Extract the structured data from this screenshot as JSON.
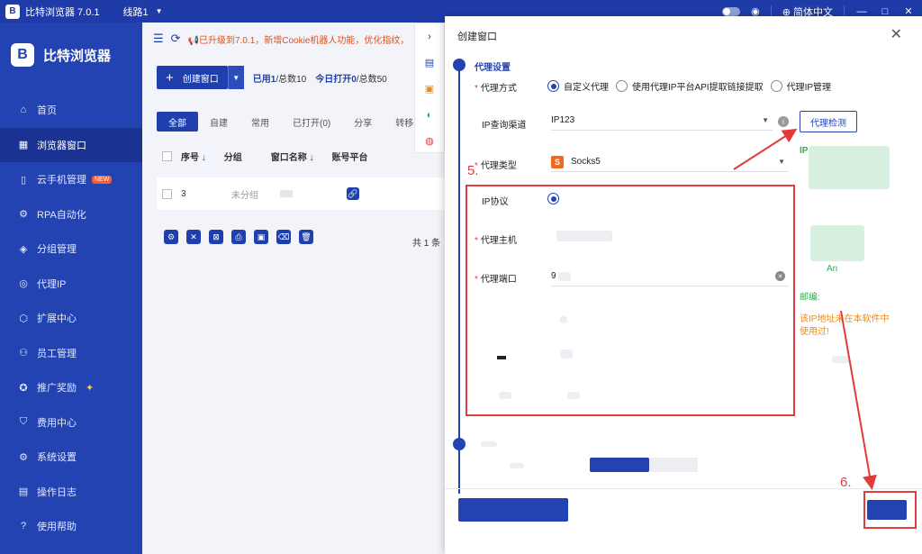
{
  "titlebar": {
    "title": "比特浏览器 7.0.1",
    "line": "线路1",
    "language": "简体中文",
    "logo_letter": "B"
  },
  "sidebar": {
    "brand": "比特浏览器",
    "items": [
      {
        "label": "首页",
        "icon": "home-icon",
        "glyph": "⌂"
      },
      {
        "label": "浏览器窗口",
        "icon": "grid-icon",
        "glyph": "▦"
      },
      {
        "label": "云手机管理",
        "icon": "phone-icon",
        "glyph": "▯",
        "badge": "NEW"
      },
      {
        "label": "RPA自动化",
        "icon": "robot-icon",
        "glyph": "⚙"
      },
      {
        "label": "分组管理",
        "icon": "layers-icon",
        "glyph": "◈"
      },
      {
        "label": "代理IP",
        "icon": "location-icon",
        "glyph": "◎"
      },
      {
        "label": "扩展中心",
        "icon": "cube-icon",
        "glyph": "⬡"
      },
      {
        "label": "员工管理",
        "icon": "users-icon",
        "glyph": "⚇"
      },
      {
        "label": "推广奖励",
        "icon": "gift-icon",
        "glyph": "✪"
      },
      {
        "label": "费用中心",
        "icon": "shield-icon",
        "glyph": "⛉"
      },
      {
        "label": "系统设置",
        "icon": "gear-icon",
        "glyph": "⚙"
      },
      {
        "label": "操作日志",
        "icon": "log-icon",
        "glyph": "▤"
      },
      {
        "label": "使用帮助",
        "icon": "help-icon",
        "glyph": "?"
      }
    ]
  },
  "main": {
    "notice": "已升级到7.0.1，新增Cookie机器人功能，优化指纹，",
    "create_button": "创建窗口",
    "stats": {
      "used_label": "已用",
      "used": "1",
      "total_label": "/总数10",
      "today_label": "今日打开",
      "today": "0",
      "today_total": "/总数50"
    },
    "tabs": [
      "全部",
      "自建",
      "常用",
      "已打开(0)",
      "分享",
      "转移"
    ],
    "columns": [
      "序号",
      "分组",
      "窗口名称",
      "账号平台"
    ],
    "row": {
      "index": "3",
      "group": "未分组"
    },
    "total": "共 1 条"
  },
  "modal": {
    "title": "创建窗口",
    "section": "代理设置",
    "proxy_method_label": "代理方式",
    "proxy_methods": [
      "自定义代理",
      "使用代理IP平台API提取链接提取",
      "代理IP管理"
    ],
    "ip_channel_label": "IP查询渠道",
    "ip_channel_value": "IP123",
    "check_button": "代理检测",
    "proxy_type_label": "代理类型",
    "proxy_type_value": "Socks5",
    "ip_protocol_label": "IP协议",
    "host_label": "代理主机",
    "port_label": "代理端口",
    "port_value": "9",
    "side_ip_label": "IP:",
    "side_zip_label": "邮编:",
    "side_warning": "该IP地址未在本软件中使用过!",
    "side_an": "An"
  },
  "annotations": {
    "step5": "5.",
    "step6": "6."
  },
  "colors": {
    "primary": "#2443b3",
    "titlebar": "#1e3ba8",
    "annotation": "#e23b3b",
    "notice": "#e0501d"
  }
}
